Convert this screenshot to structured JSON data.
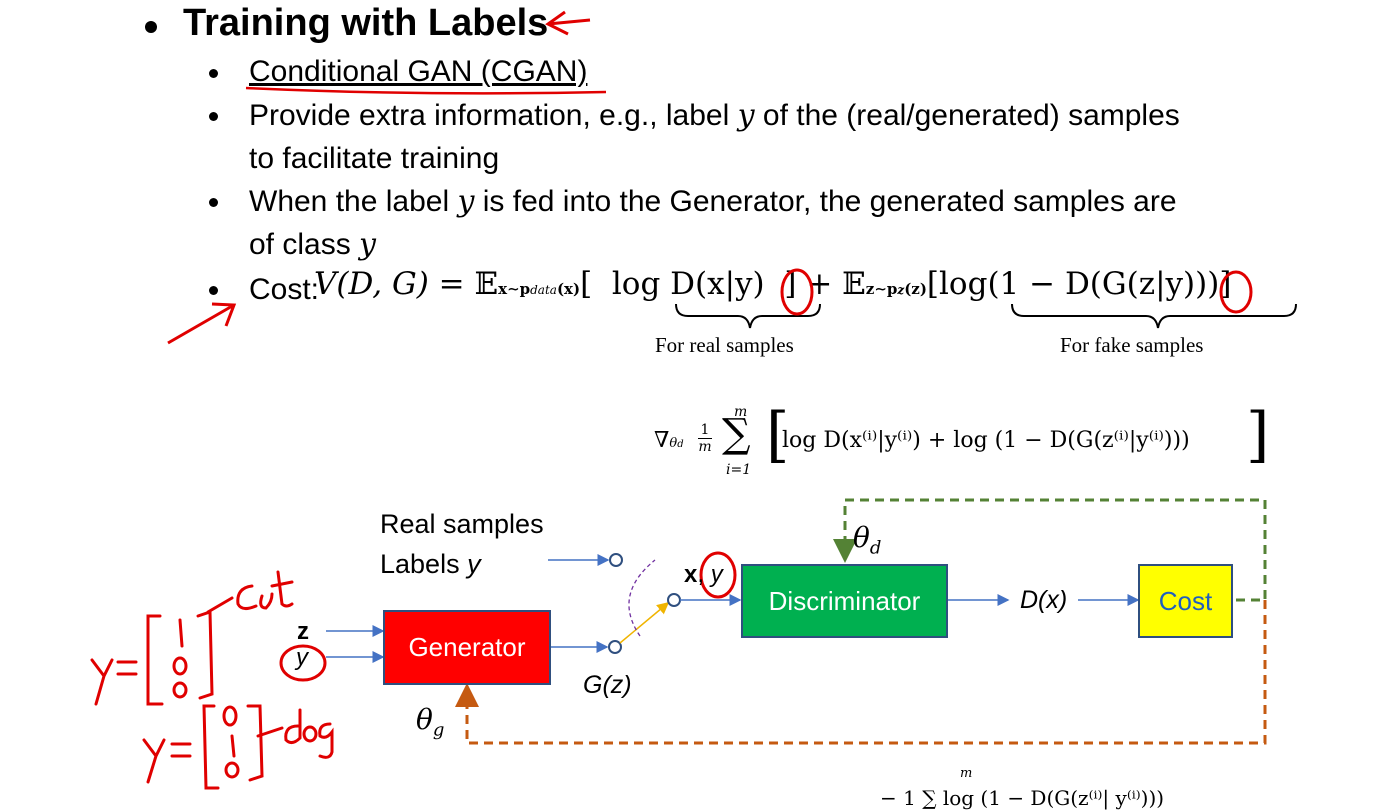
{
  "slide": {
    "title": "Training with Labels",
    "bullets": [
      {
        "text": "Conditional GAN (CGAN)"
      },
      {
        "line1_pre": "Provide extra information, e.g., label ",
        "line1_var": "y",
        "line1_post": " of the (real/generated) samples",
        "line2": "to facilitate training"
      },
      {
        "line1_pre": "When the label ",
        "line1_var": "y",
        "line1_post": " is fed into the Generator, the generated samples are",
        "line2_pre": "of class ",
        "line2_var": "y"
      },
      {
        "label": "Cost: "
      }
    ]
  },
  "cost_formula": {
    "lhs": "V(D, G) = ",
    "e1": "𝔼",
    "e1_sub": "x∼p",
    "e1_subsub": "data",
    "e1_sub_tail": "(x)",
    "term1": "log D(x|y)",
    "plus": "] + ",
    "e2": "𝔼",
    "e2_sub": "z∼p",
    "e2_subsub": "z",
    "e2_sub_tail": "(z)",
    "term2": "[log(1 − D(G(z|y)))]",
    "brace1_label": "For real samples",
    "brace2_label": "For fake samples"
  },
  "gradient_formula": {
    "nabla": "∇",
    "nabla_sub": "θ",
    "nabla_subsub": "d",
    "frac_num": "1",
    "frac_den": "m",
    "sum_top": "m",
    "sum_sym": "∑",
    "sum_bottom": "i=1",
    "body": "log D(x⁽ⁱ⁾|y⁽ⁱ⁾) + log (1 − D(G(z⁽ⁱ⁾|y⁽ⁱ⁾)))"
  },
  "diagram": {
    "real_samples": "Real samples",
    "labels_pre": "Labels ",
    "labels_var": "y",
    "generator": "Generator",
    "discriminator": "Discriminator",
    "cost": "Cost",
    "input_z": "z",
    "input_y": "y",
    "gz": "G(z)",
    "xy_x": "x",
    "xy_sep": ", ",
    "xy_y": "y",
    "dx": "D(x)",
    "theta_d": "θ",
    "theta_d_sub": "d",
    "theta_g": "θ",
    "theta_g_sub": "g"
  },
  "annotations": {
    "note1": "y=[1 0 0]-cat",
    "note2": "y=[0 1 0]-dog"
  },
  "colors": {
    "generator": "#ff0000",
    "discriminator": "#00b050",
    "cost": "#ffff00",
    "cost_text": "#1f5fbf",
    "arrow": "#4472c4",
    "theta_d_loop": "#548235",
    "theta_g_loop": "#c55a11",
    "ink": "#e00000"
  }
}
